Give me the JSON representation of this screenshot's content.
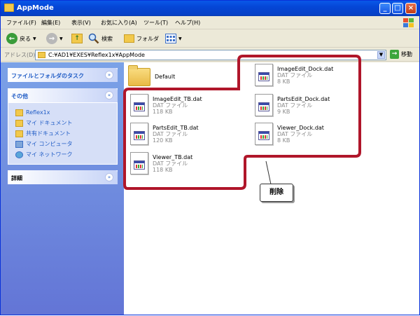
{
  "window": {
    "title": "AppMode"
  },
  "menu": [
    "ファイル(F)",
    "編集(E)",
    "表示(V)",
    "お気に入り(A)",
    "ツール(T)",
    "ヘルプ(H)"
  ],
  "toolbar": {
    "back": "戻る",
    "search": "検索",
    "folders": "フォルダ"
  },
  "address": {
    "label": "アドレス(D)",
    "path": "C:¥AD1¥EXES¥Reflex1x¥AppMode",
    "go": "移動"
  },
  "taskpane": {
    "tasks_title": "ファイルとフォルダのタスク",
    "other_title": "その他",
    "other_links": [
      "Reflex1x",
      "マイ ドキュメント",
      "共有ドキュメント",
      "マイ コンピュータ",
      "マイ ネットワーク"
    ],
    "details_title": "詳細"
  },
  "files": {
    "folder": "Default",
    "items": [
      {
        "name": "ImageEdit_Dock.dat",
        "type": "DAT ファイル",
        "size": "8 KB"
      },
      {
        "name": "ImageEdit_TB.dat",
        "type": "DAT ファイル",
        "size": "118 KB"
      },
      {
        "name": "PartsEdit_Dock.dat",
        "type": "DAT ファイル",
        "size": "9 KB"
      },
      {
        "name": "PartsEdit_TB.dat",
        "type": "DAT ファイル",
        "size": "120 KB"
      },
      {
        "name": "Viewer_Dock.dat",
        "type": "DAT ファイル",
        "size": "8 KB"
      },
      {
        "name": "Viewer_TB.dat",
        "type": "DAT ファイル",
        "size": "118 KB"
      }
    ]
  },
  "callout": {
    "label": "削除",
    "color": "#b0162a"
  }
}
